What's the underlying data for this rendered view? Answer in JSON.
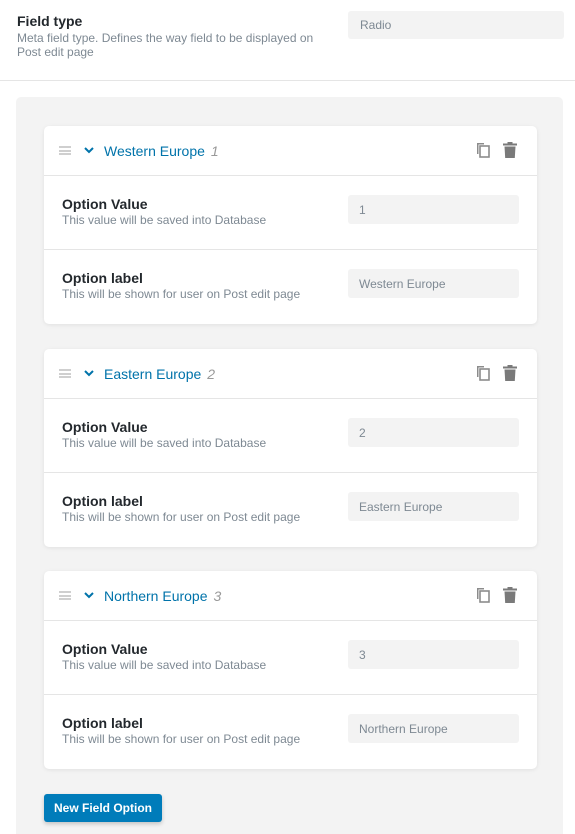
{
  "field_type": {
    "label": "Field type",
    "description": "Meta field type. Defines the way field to be displayed on Post edit page",
    "value": "Radio"
  },
  "options": [
    {
      "title": "Western Europe",
      "index": "1",
      "value_label": "Option Value",
      "value_desc": "This value will be saved into Database",
      "value": "1",
      "label_label": "Option label",
      "label_desc": "This will be shown for user on Post edit page",
      "label": "Western Europe"
    },
    {
      "title": "Eastern Europe",
      "index": "2",
      "value_label": "Option Value",
      "value_desc": "This value will be saved into Database",
      "value": "2",
      "label_label": "Option label",
      "label_desc": "This will be shown for user on Post edit page",
      "label": "Eastern Europe"
    },
    {
      "title": "Northern Europe",
      "index": "3",
      "value_label": "Option Value",
      "value_desc": "This value will be saved into Database",
      "value": "3",
      "label_label": "Option label",
      "label_desc": "This will be shown for user on Post edit page",
      "label": "Northern Europe"
    }
  ],
  "icons": {
    "drag": "drag-handle-icon",
    "toggle": "chevron-down-icon",
    "copy": "copy-icon",
    "delete": "trash-icon"
  },
  "colors": {
    "accent": "#0073aa",
    "button": "#007cba"
  },
  "new_option_button": "New Field Option"
}
